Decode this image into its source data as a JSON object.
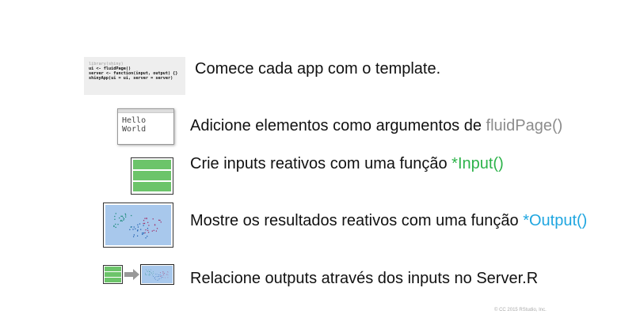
{
  "code": [
    "library(shiny)",
    "ui <- fluidPage()",
    "server <- function(input, output) {}",
    "shinyApp(ui = ui, server = server)"
  ],
  "hello_text": "Hello World",
  "steps": [
    {
      "text": "Comece cada app com o template.",
      "highlight": "",
      "color": ""
    },
    {
      "text": "Adicione elementos como argumentos de ",
      "highlight": "fluidPage()",
      "color": "#8c8c8c"
    },
    {
      "text": "Crie inputs reativos com uma função ",
      "highlight": "*Input()",
      "color": "#2db34a"
    },
    {
      "text": "Mostre os resultados reativos com uma função ",
      "highlight": "*Output()",
      "color": "#1fa6e0"
    },
    {
      "text": "Relacione outputs através dos inputs no Server.R",
      "highlight": "",
      "color": ""
    }
  ],
  "copyright": "© CC 2015 RStudio, Inc.",
  "colors": {
    "input_green": "#6cc46a",
    "plot_bg": "#a8c8ec"
  }
}
